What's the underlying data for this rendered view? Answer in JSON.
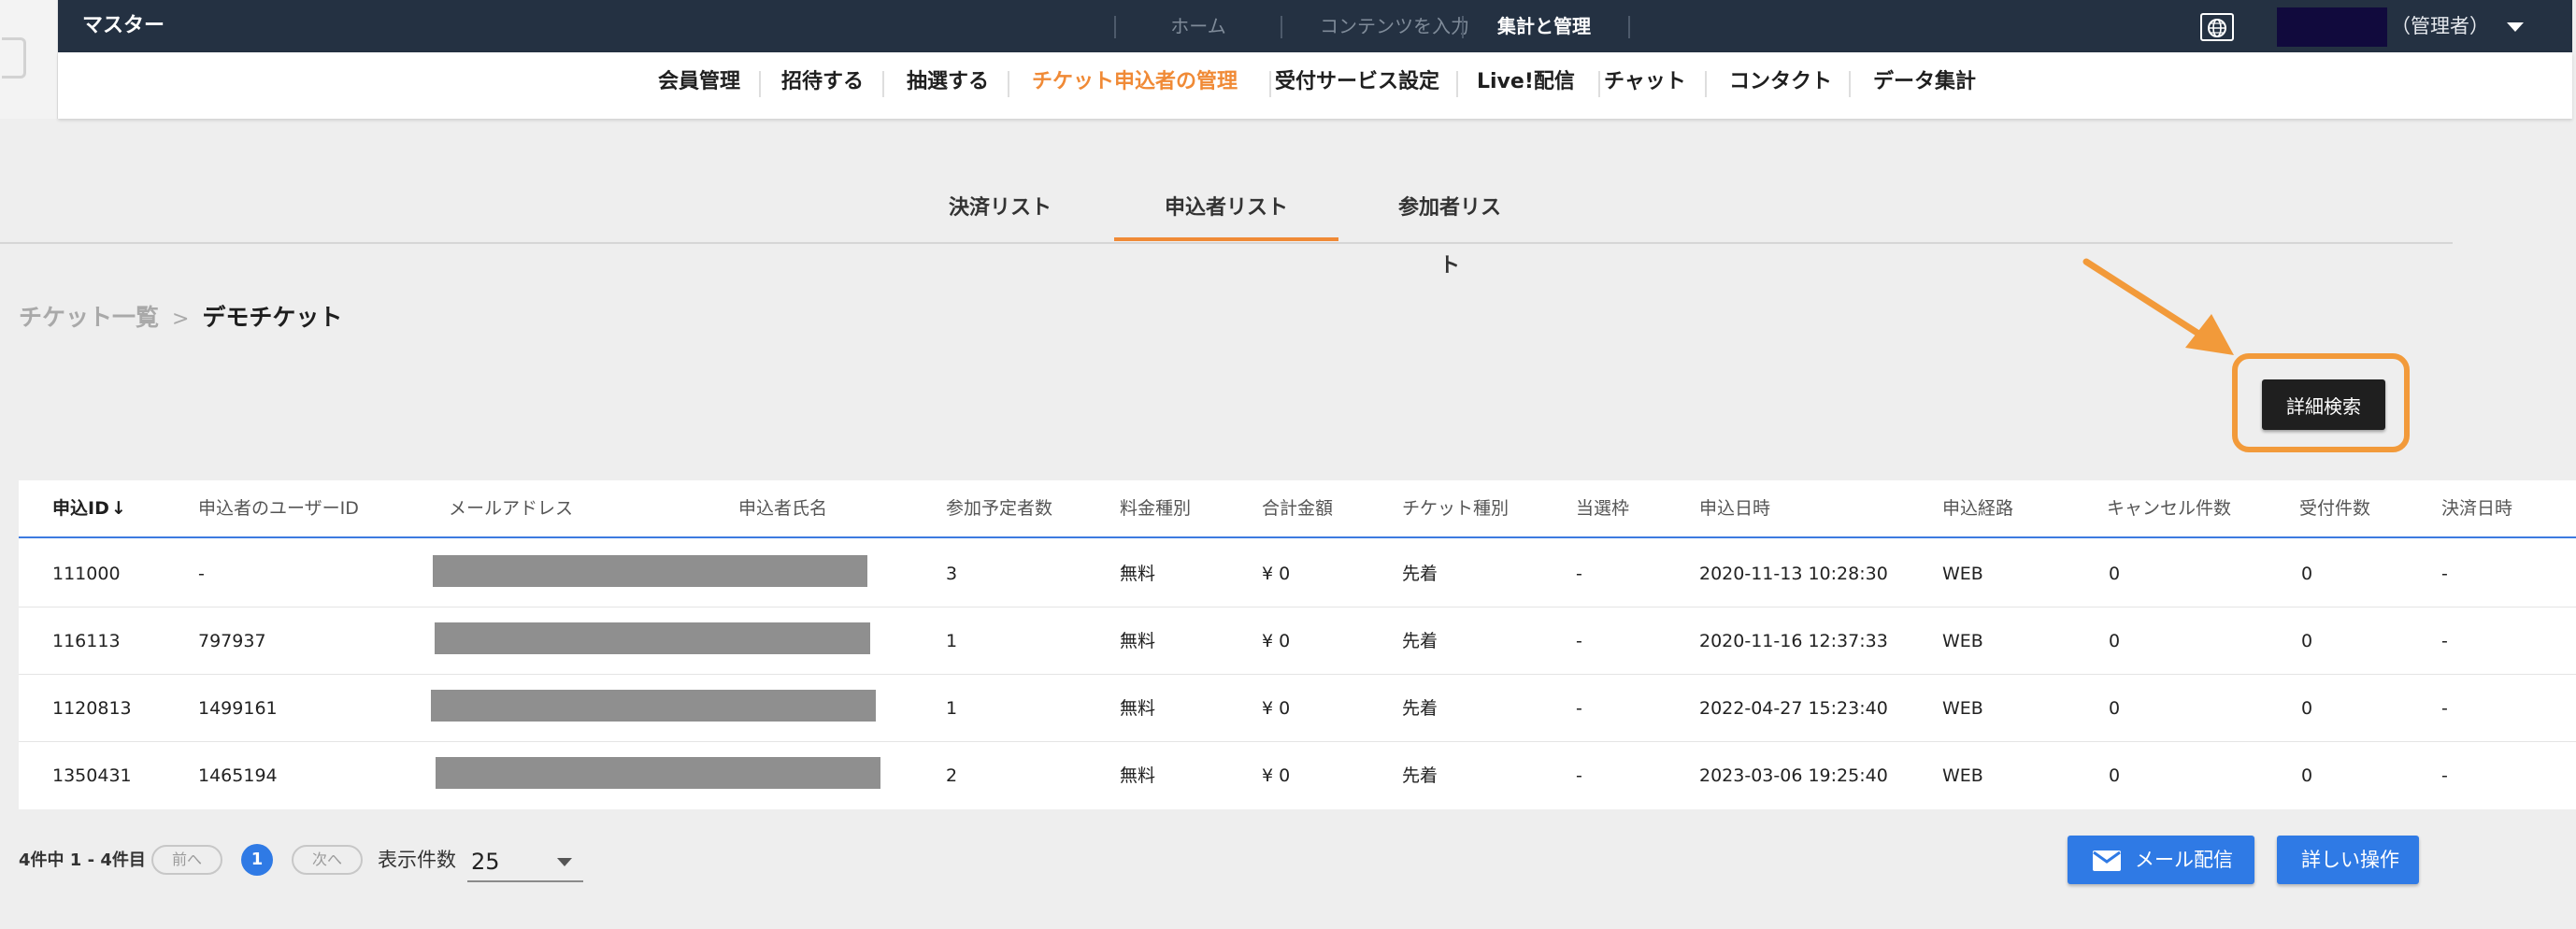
{
  "app": {
    "title": "マスター"
  },
  "topnav": {
    "items": [
      {
        "label": "ホーム"
      },
      {
        "label": "コンテンツを入力"
      },
      {
        "label": "集計と管理"
      }
    ]
  },
  "user": {
    "role_label": "（管理者）"
  },
  "subnav": {
    "items": [
      {
        "label": "会員管理"
      },
      {
        "label": "招待する"
      },
      {
        "label": "抽選する"
      },
      {
        "label": "チケット申込者の管理"
      },
      {
        "label": "受付サービス設定"
      },
      {
        "label": "Live!配信"
      },
      {
        "label": "チャット"
      },
      {
        "label": "コンタクト"
      },
      {
        "label": "データ集計"
      }
    ]
  },
  "tabs": [
    {
      "label": "決済リスト"
    },
    {
      "label": "申込者リスト"
    },
    {
      "label": "参加者リスト"
    }
  ],
  "breadcrumb": {
    "parent": "チケット一覧",
    "separator": ">",
    "current": "デモチケット"
  },
  "actions": {
    "detail_search": "詳細検索"
  },
  "table": {
    "columns": [
      "申込ID",
      "申込者のユーザーID",
      "メールアドレス",
      "申込者氏名",
      "参加予定者数",
      "料金種別",
      "合計金額",
      "チケット種別",
      "当選枠",
      "申込日時",
      "申込経路",
      "キャンセル件数",
      "受付件数",
      "決済日時"
    ],
    "sort_indicator": "↓",
    "rows": [
      {
        "id": "111000",
        "user_id": "-",
        "attendees": "3",
        "fee_type": "無料",
        "total": "¥ 0",
        "ticket_type": "先着",
        "slot": "-",
        "applied_at": "2020-11-13 10:28:30",
        "channel": "WEB",
        "cancel_count": "0",
        "accept_count": "0",
        "paid_at": "-"
      },
      {
        "id": "116113",
        "user_id": "797937",
        "attendees": "1",
        "fee_type": "無料",
        "total": "¥ 0",
        "ticket_type": "先着",
        "slot": "-",
        "applied_at": "2020-11-16 12:37:33",
        "channel": "WEB",
        "cancel_count": "0",
        "accept_count": "0",
        "paid_at": "-"
      },
      {
        "id": "1120813",
        "user_id": "1499161",
        "attendees": "1",
        "fee_type": "無料",
        "total": "¥ 0",
        "ticket_type": "先着",
        "slot": "-",
        "applied_at": "2022-04-27 15:23:40",
        "channel": "WEB",
        "cancel_count": "0",
        "accept_count": "0",
        "paid_at": "-"
      },
      {
        "id": "1350431",
        "user_id": "1465194",
        "attendees": "2",
        "fee_type": "無料",
        "total": "¥ 0",
        "ticket_type": "先着",
        "slot": "-",
        "applied_at": "2023-03-06 19:25:40",
        "channel": "WEB",
        "cancel_count": "0",
        "accept_count": "0",
        "paid_at": "-"
      }
    ]
  },
  "pagination": {
    "summary": "4件中 1 - 4件目",
    "prev": "前へ",
    "page": "1",
    "next": "次へ",
    "per_page_label": "表示件数",
    "per_page_value": "25"
  },
  "footer_actions": {
    "mail": "メール配信",
    "more": "詳しい操作"
  },
  "colors": {
    "accent": "#f08a36",
    "primary": "#2f7ae5",
    "topbar": "#243142"
  },
  "icons": {
    "mail": "mail-icon",
    "globe": "globe-icon",
    "dropdown": "chevron-down-icon",
    "sort": "sort-arrow-down-icon"
  }
}
